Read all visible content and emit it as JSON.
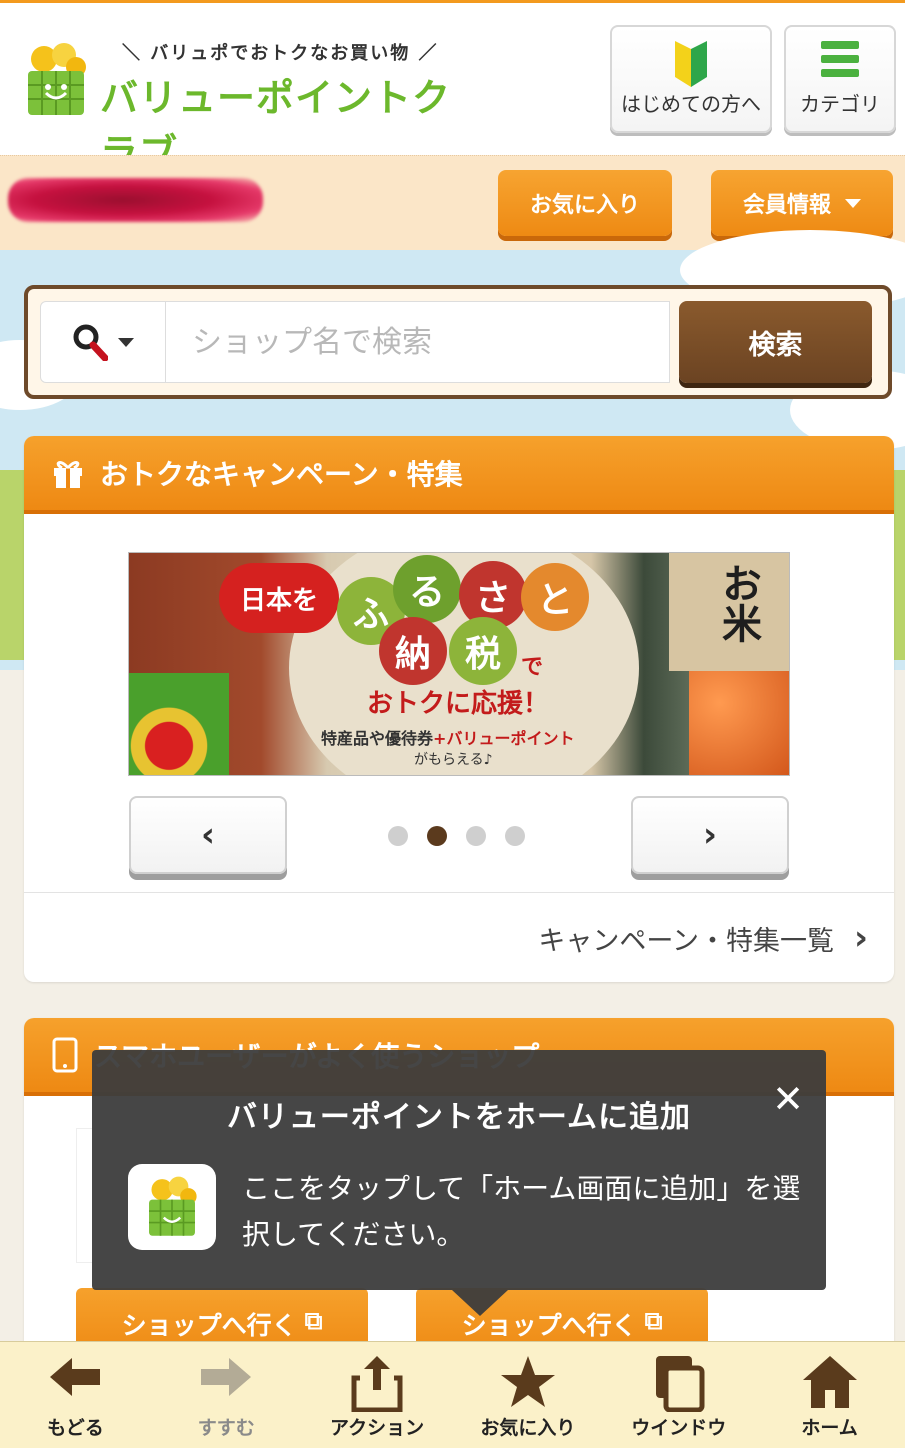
{
  "header": {
    "tagline": "＼ バリュポでおトクなお買い物 ／",
    "logo_name": "バリューポイントクラブ",
    "beginner_label": "はじめての方へ",
    "category_label": "カテゴリ"
  },
  "userbar": {
    "favorites_label": "お気に入り",
    "member_label": "会員情報"
  },
  "search": {
    "placeholder": "ショップ名で検索",
    "button_label": "検索"
  },
  "campaign": {
    "heading": "おトクなキャンペーン・特集",
    "banner": {
      "tag": "日本を",
      "balls": [
        "ふ",
        "る",
        "さ",
        "と",
        "納",
        "税"
      ],
      "de": "で",
      "headline": "おトクに応援！",
      "sub_a": "特産品",
      "sub_ya": "や",
      "sub_b": "優待券",
      "sub_plus": "+バリューポイント",
      "sub_c": "がもらえる♪",
      "rice": "お米"
    },
    "slides_total": 4,
    "slide_active": 2,
    "prev_glyph": "‹",
    "next_glyph": "›",
    "more_label": "キャンペーン・特集一覧",
    "more_glyph": "›"
  },
  "shops": {
    "heading": "スマホユーザーがよく使うショップ",
    "go_button_label": "ショップへ行く",
    "go_icon": "⧉"
  },
  "popup": {
    "title": "バリューポイントをホームに追加",
    "body": "ここをタップして「ホーム画面に追加」を選択してください。",
    "close_glyph": "✕"
  },
  "toolbar": {
    "items": [
      {
        "label": "もどる",
        "icon": "arrow-left-icon"
      },
      {
        "label": "すすむ",
        "icon": "arrow-right-icon"
      },
      {
        "label": "アクション",
        "icon": "share-icon"
      },
      {
        "label": "お気に入り",
        "icon": "star-icon"
      },
      {
        "label": "ウインドウ",
        "icon": "windows-icon"
      },
      {
        "label": "ホーム",
        "icon": "home-icon"
      }
    ]
  },
  "colors": {
    "accent_orange": "#ee8913",
    "brand_green": "#6cb82c",
    "search_brown": "#6b4322",
    "toolbar_bg": "#fbf1c9"
  }
}
